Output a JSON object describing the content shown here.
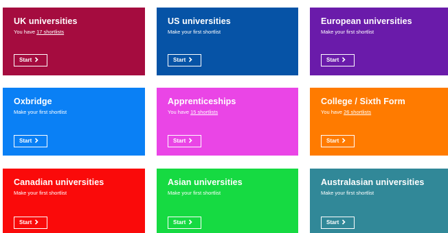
{
  "tiles": [
    {
      "id": "uk",
      "title": "UK universities",
      "subtitle_prefix": "You have ",
      "subtitle_link": "17 shortlists",
      "subtitle": "",
      "button": "Start",
      "color": "#A50C3F"
    },
    {
      "id": "us",
      "title": "US universities",
      "subtitle_prefix": "",
      "subtitle_link": "",
      "subtitle": "Make your first shortlist",
      "button": "Start",
      "color": "#0653A6"
    },
    {
      "id": "european",
      "title": "European universities",
      "subtitle_prefix": "",
      "subtitle_link": "",
      "subtitle": "Make your first shortlist",
      "button": "Start",
      "color": "#6A1BAA"
    },
    {
      "id": "oxbridge",
      "title": "Oxbridge",
      "subtitle_prefix": "",
      "subtitle_link": "",
      "subtitle": "Make your first shortlist",
      "button": "Start",
      "color": "#0A80F5"
    },
    {
      "id": "apprenticeships",
      "title": "Apprenticeships",
      "subtitle_prefix": "You have ",
      "subtitle_link": "15 shortlists",
      "subtitle": "",
      "button": "Start",
      "color": "#EA45E6"
    },
    {
      "id": "college",
      "title": "College / Sixth Form",
      "subtitle_prefix": "You have ",
      "subtitle_link": "26 shortlists",
      "subtitle": "",
      "button": "Start",
      "color": "#FF7B00"
    },
    {
      "id": "canadian",
      "title": "Canadian universities",
      "subtitle_prefix": "",
      "subtitle_link": "",
      "subtitle": "Make your first shortlist",
      "button": "Start",
      "color": "#FA0A0A"
    },
    {
      "id": "asian",
      "title": "Asian universities",
      "subtitle_prefix": "",
      "subtitle_link": "",
      "subtitle": "Make your first shortlist",
      "button": "Start",
      "color": "#16DA42"
    },
    {
      "id": "australasian",
      "title": "Australasian universities",
      "subtitle_prefix": "",
      "subtitle_link": "",
      "subtitle": "Make your first shortlist",
      "button": "Start",
      "color": "#318898"
    }
  ],
  "icons": {
    "button_icon": "chevron-right-icon"
  }
}
